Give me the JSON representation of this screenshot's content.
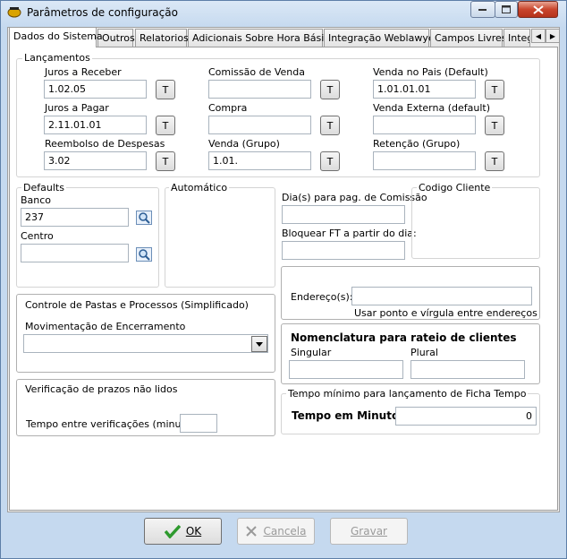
{
  "window": {
    "title": "Parâmetros de configuração"
  },
  "tabs": [
    {
      "label": "Dados do Sistema",
      "active": true
    },
    {
      "label": "Outros"
    },
    {
      "label": "Relatorios"
    },
    {
      "label": "Adicionais Sobre Hora Básica"
    },
    {
      "label": "Integração Weblawyer"
    },
    {
      "label": "Campos Livres"
    },
    {
      "label": "Integ"
    }
  ],
  "lancamentos": {
    "title": "Lançamentos",
    "button_label": "T",
    "fields": [
      {
        "label": "Juros a Receber",
        "value": "1.02.05"
      },
      {
        "label": "Juros a Pagar",
        "value": "2.11.01.01"
      },
      {
        "label": "Reembolso de Despesas",
        "value": "3.02"
      },
      {
        "label": "Comissão de Venda",
        "value": ""
      },
      {
        "label": "Compra",
        "value": ""
      },
      {
        "label": "Venda (Grupo)",
        "value": "1.01."
      },
      {
        "label": "Venda no Pais (Default)",
        "value": "1.01.01.01"
      },
      {
        "label": "Venda Externa (default)",
        "value": ""
      },
      {
        "label": "Retenção (Grupo)",
        "value": ""
      }
    ]
  },
  "defaults": {
    "title": "Defaults",
    "banco_label": "Banco",
    "banco_value": "237",
    "centro_label": "Centro",
    "centro_value": ""
  },
  "automatico": {
    "title": "Automático"
  },
  "comissao": {
    "dias_label": "Dia(s) para pag. de Comissão",
    "dias_value": "",
    "bloquear_label": "Bloquear FT a partir do dia:",
    "bloquear_value": ""
  },
  "codigo_cliente": {
    "title": "Codigo Cliente"
  },
  "controle": {
    "title": "Controle de Pastas e Processos (Simplificado)",
    "mov_label": "Movimentação de Encerramento",
    "mov_value": ""
  },
  "enderecos": {
    "label": "Endereço(s):",
    "value": "",
    "hint": "Usar ponto e vírgula entre endereços"
  },
  "nomenclatura": {
    "title": "Nomenclatura para rateio de clientes",
    "singular_label": "Singular",
    "singular_value": "",
    "plural_label": "Plural",
    "plural_value": ""
  },
  "verificacao": {
    "title": "Verificação de prazos não lidos",
    "tempo_label": "Tempo entre verificações (minutos):",
    "tempo_value": ""
  },
  "tempo_minimo": {
    "title": "Tempo mínimo para lançamento de Ficha Tempo",
    "label": "Tempo em Minutos",
    "value": "0"
  },
  "buttons": {
    "ok": "OK",
    "cancel": "Cancela",
    "save": "Gravar"
  },
  "colors": {
    "ok_check": "#2e9a2e",
    "cancel_x": "#9a9a9a",
    "title_bar": "#c5d9ef"
  }
}
